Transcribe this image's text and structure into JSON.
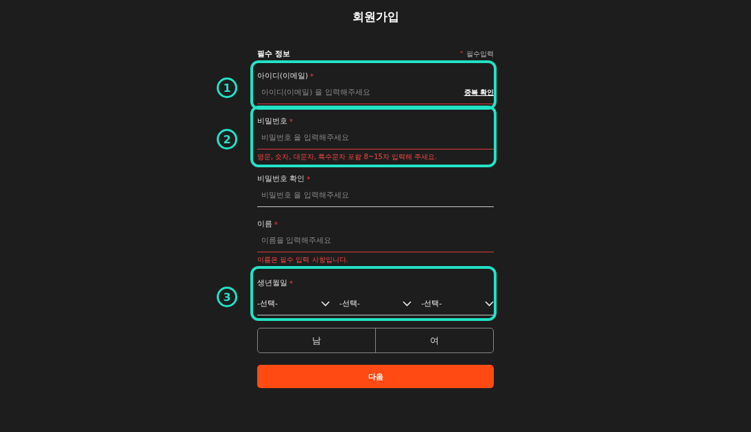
{
  "title": "회원가입",
  "section": {
    "title": "필수 정보",
    "required_note": "필수입력",
    "required_mark": "*"
  },
  "fields": [
    {
      "kind": "text",
      "label": "아이디(이메일)",
      "required": true,
      "placeholder": "아이디(이메일) 을 입력해주세요",
      "action": "중복 확인",
      "invalid": true,
      "annotation": "1"
    },
    {
      "kind": "text",
      "label": "비밀번호",
      "required": true,
      "placeholder": "비밀번호 을 입력해주세요",
      "invalid": true,
      "error": "영문, 숫자, 대문자, 특수문자 포함 8~15자 입력해 주세요.",
      "annotation": "2"
    },
    {
      "kind": "text",
      "label": "비밀번호 확인",
      "required": true,
      "placeholder": "비밀번호 을 입력해주세요",
      "invalid": false
    },
    {
      "kind": "text",
      "label": "이름",
      "required": true,
      "placeholder": "이름을 입력해주세요",
      "invalid": true,
      "error": "이름은 필수 입력 사항입니다."
    },
    {
      "kind": "select",
      "label": "생년월일",
      "required": true,
      "options": [
        "-선택-",
        "-선택-",
        "-선택-"
      ],
      "invalid": false,
      "annotation": "3"
    }
  ],
  "gender": [
    {
      "label": "남",
      "selected": false
    },
    {
      "label": "여",
      "selected": false
    }
  ],
  "next_button": "다음"
}
